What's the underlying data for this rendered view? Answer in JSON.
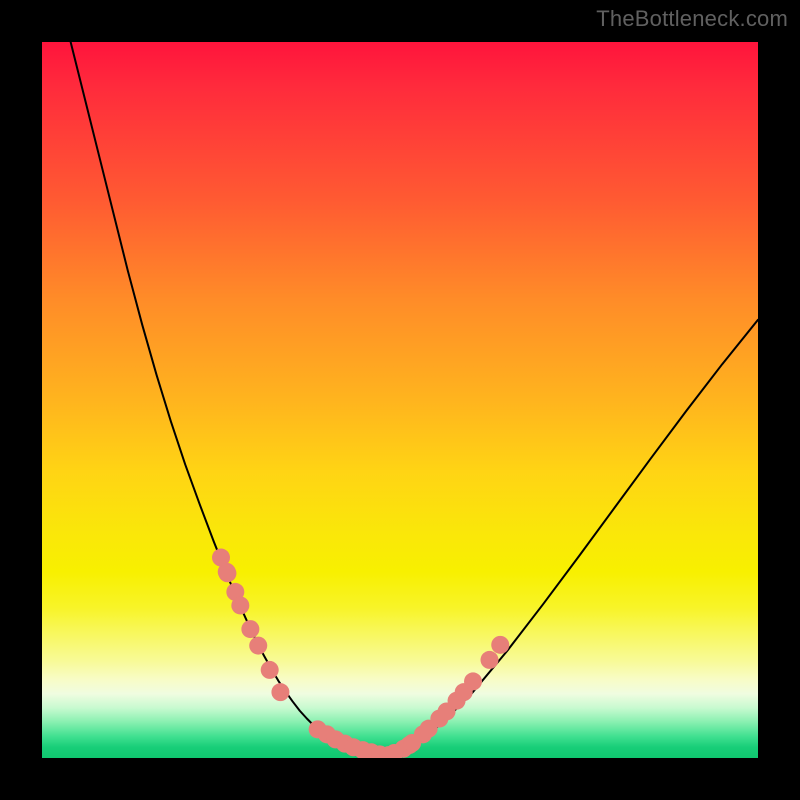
{
  "watermark": "TheBottleneck.com",
  "chart_data": {
    "type": "line",
    "title": "",
    "xlabel": "",
    "ylabel": "",
    "xlim": [
      0,
      100
    ],
    "ylim": [
      0,
      100
    ],
    "grid": false,
    "background_gradient_stops": [
      {
        "pos": 0,
        "color": "#ff143c"
      },
      {
        "pos": 0.06,
        "color": "#ff2a3c"
      },
      {
        "pos": 0.22,
        "color": "#ff5a32"
      },
      {
        "pos": 0.36,
        "color": "#ff8c28"
      },
      {
        "pos": 0.5,
        "color": "#ffb41e"
      },
      {
        "pos": 0.6,
        "color": "#ffd414"
      },
      {
        "pos": 0.68,
        "color": "#fae60a"
      },
      {
        "pos": 0.74,
        "color": "#f8f000"
      },
      {
        "pos": 0.79,
        "color": "#f8f428"
      },
      {
        "pos": 0.83,
        "color": "#f8f864"
      },
      {
        "pos": 0.865,
        "color": "#f8fa98"
      },
      {
        "pos": 0.89,
        "color": "#f8fcc6"
      },
      {
        "pos": 0.91,
        "color": "#f0fce0"
      },
      {
        "pos": 0.93,
        "color": "#c8fad0"
      },
      {
        "pos": 0.95,
        "color": "#88f0b0"
      },
      {
        "pos": 0.97,
        "color": "#40e090"
      },
      {
        "pos": 0.985,
        "color": "#18ce78"
      },
      {
        "pos": 1.0,
        "color": "#10c870"
      }
    ],
    "series": [
      {
        "name": "bottleneck-curve",
        "type": "line",
        "color": "#000000",
        "x": [
          4,
          6,
          8,
          10,
          12,
          14,
          16,
          18,
          20,
          22,
          24,
          26,
          28,
          29,
          30,
          31,
          32,
          33,
          34,
          35,
          36,
          37,
          38,
          39,
          40,
          42,
          44,
          46,
          48,
          50,
          53,
          56,
          60,
          65,
          70,
          75,
          80,
          85,
          90,
          95,
          100
        ],
        "values": [
          100,
          92,
          84,
          76,
          68,
          60.5,
          53.5,
          47,
          41,
          35.5,
          30.2,
          25.2,
          20.5,
          18.3,
          16.2,
          14.3,
          12.5,
          10.8,
          9.3,
          7.9,
          6.6,
          5.5,
          4.5,
          3.6,
          2.9,
          1.8,
          1.1,
          0.6,
          0.3,
          0.9,
          2.5,
          5,
          9,
          15,
          21.5,
          28.2,
          35,
          41.8,
          48.5,
          55,
          61.2
        ]
      },
      {
        "name": "left-branch-markers",
        "type": "scatter",
        "color": "#e77f79",
        "x": [
          25.0,
          25.8,
          25.9,
          27.0,
          27.7,
          29.1,
          30.2,
          31.8,
          33.3
        ],
        "values": [
          28.0,
          26.0,
          25.8,
          23.2,
          21.3,
          18.0,
          15.7,
          12.3,
          9.2
        ]
      },
      {
        "name": "right-branch-markers",
        "type": "scatter",
        "color": "#e77f79",
        "x": [
          50.5,
          51.3,
          51.7,
          53.2,
          54.0,
          55.5,
          56.5,
          57.9,
          58.9,
          60.2,
          62.5,
          64.0
        ],
        "values": [
          1.3,
          1.8,
          2.1,
          3.3,
          4.1,
          5.5,
          6.5,
          8.0,
          9.2,
          10.7,
          13.7,
          15.8
        ]
      },
      {
        "name": "valley-markers",
        "type": "scatter",
        "color": "#e77f79",
        "x": [
          38.5,
          39.8,
          41.0,
          42.3,
          43.5,
          44.8,
          46.0,
          47.2,
          48.4,
          49.2
        ],
        "values": [
          4.0,
          3.3,
          2.6,
          2.0,
          1.5,
          1.1,
          0.8,
          0.5,
          0.4,
          0.7
        ]
      }
    ]
  }
}
